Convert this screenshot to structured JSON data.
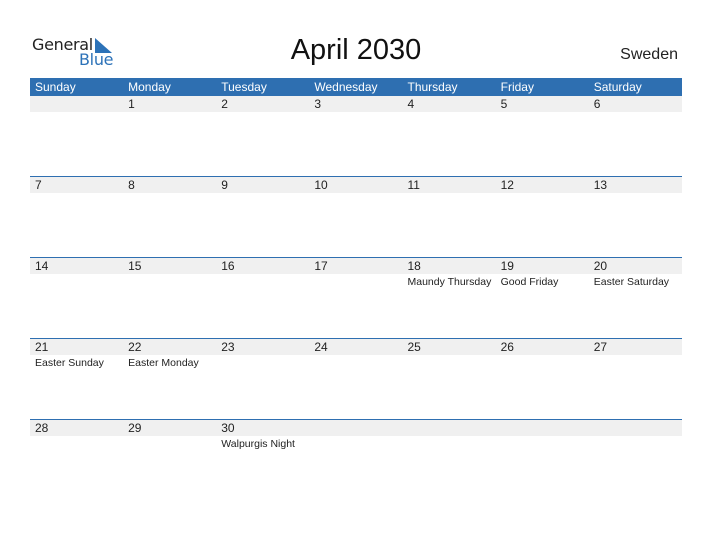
{
  "logo": {
    "word1": "General",
    "word2": "Blue"
  },
  "title": "April 2030",
  "country": "Sweden",
  "colors": {
    "accent": "#2e6fb1",
    "row_shade": "#f0f0f0"
  },
  "weekdays": [
    "Sunday",
    "Monday",
    "Tuesday",
    "Wednesday",
    "Thursday",
    "Friday",
    "Saturday"
  ],
  "weeks": [
    {
      "days": [
        "",
        "1",
        "2",
        "3",
        "4",
        "5",
        "6"
      ],
      "holidays": [
        "",
        "",
        "",
        "",
        "",
        "",
        ""
      ]
    },
    {
      "days": [
        "7",
        "8",
        "9",
        "10",
        "11",
        "12",
        "13"
      ],
      "holidays": [
        "",
        "",
        "",
        "",
        "",
        "",
        ""
      ]
    },
    {
      "days": [
        "14",
        "15",
        "16",
        "17",
        "18",
        "19",
        "20"
      ],
      "holidays": [
        "",
        "",
        "",
        "",
        "Maundy Thursday",
        "Good Friday",
        "Easter Saturday"
      ]
    },
    {
      "days": [
        "21",
        "22",
        "23",
        "24",
        "25",
        "26",
        "27"
      ],
      "holidays": [
        "Easter Sunday",
        "Easter Monday",
        "",
        "",
        "",
        "",
        ""
      ]
    },
    {
      "days": [
        "28",
        "29",
        "30",
        "",
        "",
        "",
        ""
      ],
      "holidays": [
        "",
        "",
        "Walpurgis Night",
        "",
        "",
        "",
        ""
      ]
    }
  ]
}
